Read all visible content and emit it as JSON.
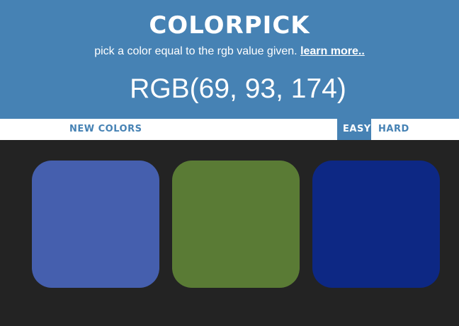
{
  "header": {
    "title": "COLORPICK",
    "subtitle_text": "pick a color equal to the rgb value given. ",
    "learn_more": "learn more..",
    "rgb_value": "RGB(69, 93, 174)"
  },
  "controls": {
    "new_colors": "NEW COLORS",
    "easy": "EASY",
    "hard": "HARD",
    "active_mode": "easy"
  },
  "squares": [
    {
      "color": "#455fae"
    },
    {
      "color": "#5a7b35"
    },
    {
      "color": "#0d2884"
    }
  ],
  "colors": {
    "header_bg": "#4682b4",
    "page_bg": "#232323",
    "stripe_bg": "#ffffff"
  }
}
